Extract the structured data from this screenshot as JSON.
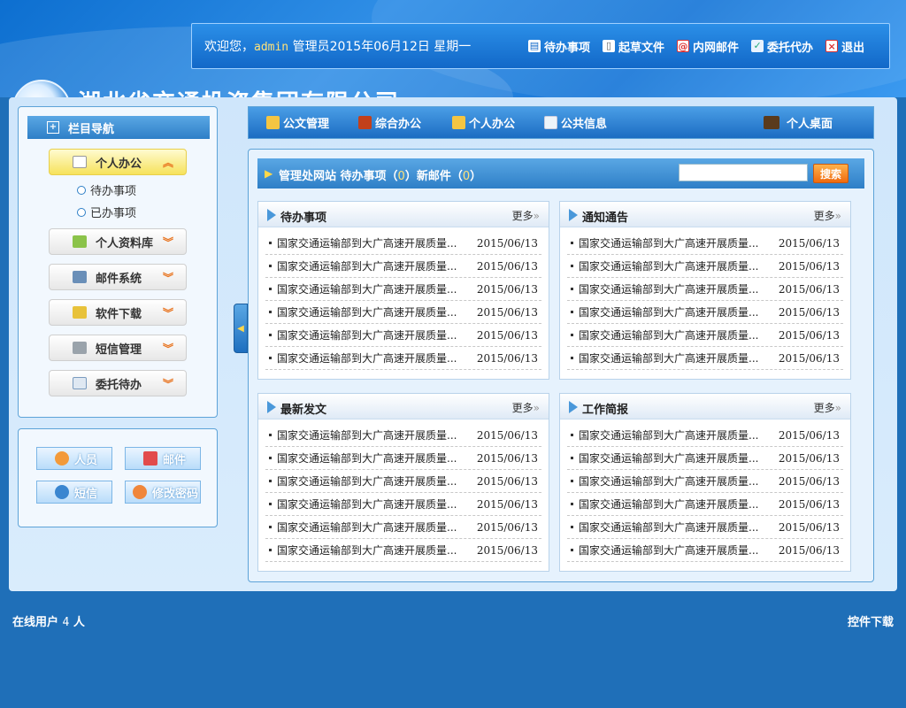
{
  "header": {
    "company_name": "湖北省交通投资集团有限公司",
    "welcome_prefix": "欢迎您，",
    "username": "admin",
    "role_date": " 管理员2015年06月12日 星期一",
    "actions": [
      {
        "label": "待办事项",
        "icon": "calendar-icon"
      },
      {
        "label": "起草文件",
        "icon": "document-icon"
      },
      {
        "label": "内网邮件",
        "icon": "mail-icon"
      },
      {
        "label": "委托代办",
        "icon": "delegate-icon"
      },
      {
        "label": "退出",
        "icon": "exit-icon"
      }
    ]
  },
  "sidebar": {
    "title": "栏目导航",
    "items": [
      {
        "label": "个人办公",
        "active": true
      },
      {
        "label": "个人资料库"
      },
      {
        "label": "邮件系统"
      },
      {
        "label": "软件下载"
      },
      {
        "label": "短信管理"
      },
      {
        "label": "委托待办"
      }
    ],
    "subitems": [
      "待办事项",
      "已办事项"
    ]
  },
  "quick": {
    "people": "人员",
    "mail": "邮件",
    "sms": "短信",
    "password": "修改密码"
  },
  "tabs": {
    "doc": "公文管理",
    "general": "综合办公",
    "personal": "个人办公",
    "public": "公共信息",
    "desktop": "个人桌面"
  },
  "site": {
    "prefix": "管理处网站 待办事项（",
    "pending_count": "0",
    "mid": "）新邮件（",
    "mail_count": "0",
    "suffix": "）",
    "search_placeholder": "",
    "search_label": "搜索"
  },
  "more_label": "更多",
  "boxes": [
    {
      "title": "待办事项",
      "rows": [
        {
          "text": "国家交通运输部到大广高速开展质量...",
          "date": "2015/06/13"
        },
        {
          "text": "国家交通运输部到大广高速开展质量...",
          "date": "2015/06/13"
        },
        {
          "text": "国家交通运输部到大广高速开展质量...",
          "date": "2015/06/13"
        },
        {
          "text": "国家交通运输部到大广高速开展质量...",
          "date": "2015/06/13"
        },
        {
          "text": "国家交通运输部到大广高速开展质量...",
          "date": "2015/06/13"
        },
        {
          "text": "国家交通运输部到大广高速开展质量...",
          "date": "2015/06/13"
        }
      ]
    },
    {
      "title": "通知通告",
      "rows": [
        {
          "text": "国家交通运输部到大广高速开展质量...",
          "date": "2015/06/13"
        },
        {
          "text": "国家交通运输部到大广高速开展质量...",
          "date": "2015/06/13"
        },
        {
          "text": "国家交通运输部到大广高速开展质量...",
          "date": "2015/06/13"
        },
        {
          "text": "国家交通运输部到大广高速开展质量...",
          "date": "2015/06/13"
        },
        {
          "text": "国家交通运输部到大广高速开展质量...",
          "date": "2015/06/13"
        },
        {
          "text": "国家交通运输部到大广高速开展质量...",
          "date": "2015/06/13"
        }
      ]
    },
    {
      "title": "最新发文",
      "rows": [
        {
          "text": "国家交通运输部到大广高速开展质量...",
          "date": "2015/06/13"
        },
        {
          "text": "国家交通运输部到大广高速开展质量...",
          "date": "2015/06/13"
        },
        {
          "text": "国家交通运输部到大广高速开展质量...",
          "date": "2015/06/13"
        },
        {
          "text": "国家交通运输部到大广高速开展质量...",
          "date": "2015/06/13"
        },
        {
          "text": "国家交通运输部到大广高速开展质量...",
          "date": "2015/06/13"
        },
        {
          "text": "国家交通运输部到大广高速开展质量...",
          "date": "2015/06/13"
        }
      ]
    },
    {
      "title": "工作简报",
      "rows": [
        {
          "text": "国家交通运输部到大广高速开展质量...",
          "date": "2015/06/13"
        },
        {
          "text": "国家交通运输部到大广高速开展质量...",
          "date": "2015/06/13"
        },
        {
          "text": "国家交通运输部到大广高速开展质量...",
          "date": "2015/06/13"
        },
        {
          "text": "国家交通运输部到大广高速开展质量...",
          "date": "2015/06/13"
        },
        {
          "text": "国家交通运输部到大广高速开展质量...",
          "date": "2015/06/13"
        },
        {
          "text": "国家交通运输部到大广高速开展质量...",
          "date": "2015/06/13"
        }
      ]
    }
  ],
  "footer": {
    "online_prefix": "在线用户",
    "online_count": "4",
    "online_suffix": "人",
    "download": "控件下载"
  }
}
